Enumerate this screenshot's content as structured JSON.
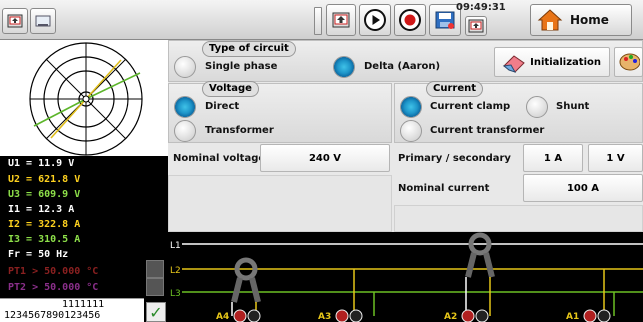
{
  "topbar": {
    "clock": "09:49:31",
    "home_label": "Home"
  },
  "measurements": {
    "lines": [
      {
        "text": "U1 = 11.9  V",
        "color": "#ffffff"
      },
      {
        "text": "U2 = 621.8 V",
        "color": "#ffd21f"
      },
      {
        "text": "U3 = 609.9 V",
        "color": "#8ee04a"
      },
      {
        "text": "I1 = 12.3  A",
        "color": "#ffffff"
      },
      {
        "text": "I2 = 322.8 A",
        "color": "#ffd21f"
      },
      {
        "text": "I3 = 310.5 A",
        "color": "#8ee04a"
      },
      {
        "text": "Fr = 50 Hz",
        "color": "#ffffff"
      },
      {
        "text": "PT1 > 50.000 °C",
        "color": "#8a2020"
      },
      {
        "text": "PT2 > 50.000 °C",
        "color": "#8a2f8a"
      }
    ],
    "counter_top": "1111111",
    "counter_bottom": "1234567890123456"
  },
  "circuit": {
    "title": "Type of circuit",
    "single_phase": "Single phase",
    "delta": "Delta (Aaron)",
    "selected": "delta",
    "init_label": "Initialization"
  },
  "voltage": {
    "title": "Voltage",
    "direct": "Direct",
    "transformer": "Transformer",
    "selected": "direct",
    "nominal_label": "Nominal voltage",
    "nominal_value": "240 V"
  },
  "current": {
    "title": "Current",
    "clamp": "Current clamp",
    "shunt": "Shunt",
    "transformer": "Current transformer",
    "selected": "clamp",
    "primary_label": "Primary / secondary",
    "primary_value": "1 A",
    "secondary_value": "1 V",
    "nominal_label": "Nominal current",
    "nominal_value": "100 A"
  },
  "wiring": {
    "lines": [
      "L1",
      "L2",
      "L3"
    ],
    "terminals": [
      "A4",
      "A3",
      "A2",
      "A1"
    ],
    "line_colors": [
      "#ffffff",
      "#e6c619",
      "#6cc024"
    ]
  },
  "colors": {
    "accent": "#1e95c9",
    "record": "#d01818"
  }
}
